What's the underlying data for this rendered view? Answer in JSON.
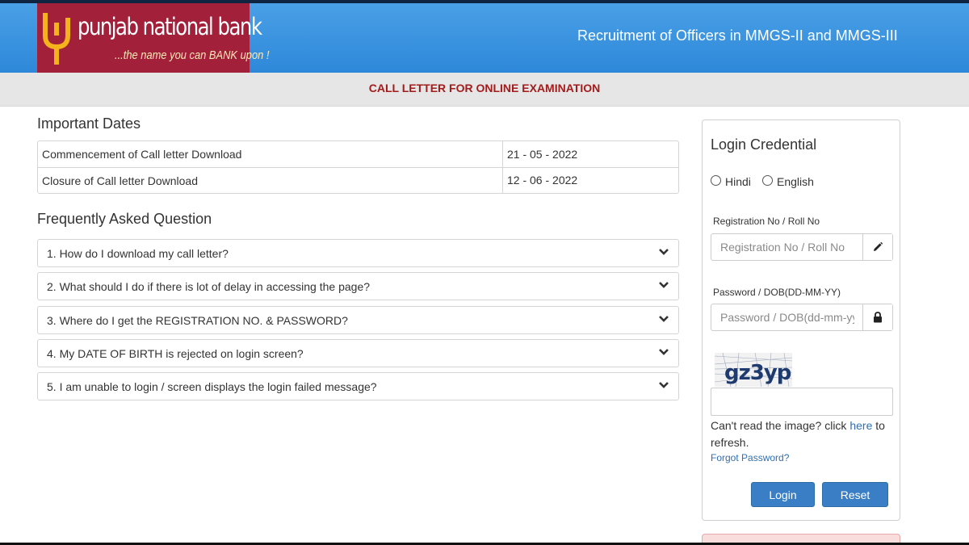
{
  "header": {
    "bank_name": "punjab national bank",
    "tagline": "...the name you can BANK upon !",
    "title": "Recruitment of Officers in MMGS-II and MMGS-III"
  },
  "subbar": {
    "text": "CALL LETTER FOR ONLINE EXAMINATION"
  },
  "important_dates": {
    "heading": "Important Dates",
    "rows": [
      {
        "label": "Commencement of Call letter Download",
        "value": "21 - 05 - 2022"
      },
      {
        "label": "Closure of Call letter Download",
        "value": "12 - 06 - 2022"
      }
    ]
  },
  "faq": {
    "heading": "Frequently Asked Question",
    "items": [
      "1. How do I download my call letter?",
      "2. What should I do if there is lot of delay in accessing the page?",
      "3. Where do I get the REGISTRATION NO. & PASSWORD?",
      "4. My DATE OF BIRTH is rejected on login screen?",
      "5. I am unable to login / screen displays the login failed message?"
    ],
    "chevron_icon": "chevron-down-icon"
  },
  "login": {
    "title": "Login Credential",
    "languages": [
      "Hindi",
      "English"
    ],
    "registration_label": "Registration No / Roll No",
    "registration_placeholder": "Registration No / Roll No",
    "registration_icon": "pencil-icon",
    "password_label": "Password / DOB(DD-MM-YY)",
    "password_placeholder": "Password / DOB(dd-mm-yy)",
    "password_icon": "lock-icon",
    "captcha_text": "gz3yp",
    "hint_prefix": "Can't read the image? click ",
    "hint_link": "here",
    "hint_suffix": " to refresh.",
    "forgot": "Forgot Password?",
    "login_button": "Login",
    "reset_button": "Reset"
  },
  "colors": {
    "header_blue": "#2e88d9",
    "logo_maroon": "#a3203a",
    "subbar_text": "#a21c1c",
    "button_blue": "#3a7ec6",
    "link_blue": "#2f6fb0"
  }
}
